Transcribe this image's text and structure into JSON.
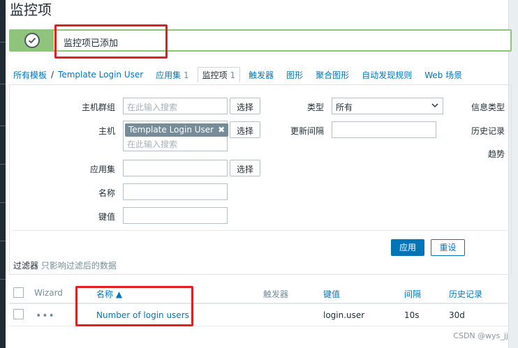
{
  "page": {
    "title": "监控项"
  },
  "message": {
    "text": "监控项已添加",
    "icon": "check-circle-icon",
    "color": "#8fc47d"
  },
  "breadcrumbs": {
    "all_templates": "所有模板",
    "separator": "/",
    "template": "Template Login User",
    "tabs": [
      {
        "label": "应用集",
        "count": "1"
      },
      {
        "label": "监控项",
        "count": "1"
      },
      {
        "label": "触发器",
        "count": ""
      },
      {
        "label": "图形",
        "count": ""
      },
      {
        "label": "聚合图形",
        "count": ""
      },
      {
        "label": "自动发现规则",
        "count": ""
      },
      {
        "label": "Web 场景",
        "count": ""
      }
    ]
  },
  "filter": {
    "host_group_label": "主机群组",
    "host_group_placeholder": "在此输入搜索",
    "select_label": "选择",
    "host_label": "主机",
    "host_tag": "Template Login User",
    "host_tag_remove": "✖",
    "host_placeholder": "在此输入搜索",
    "app_label": "应用集",
    "name_label": "名称",
    "key_label": "键值",
    "type_label": "类型",
    "type_value": "所有",
    "interval_label": "更新间隔",
    "info_type_label": "信息类型",
    "history_label": "历史记录",
    "trend_label": "趋势",
    "apply_label": "应用",
    "reset_label": "重设",
    "note_title": "过滤器",
    "note_text": "只影响过滤后的数据"
  },
  "table": {
    "headers": {
      "wizard": "Wizard",
      "name": "名称 ▲",
      "triggers": "触发器",
      "key": "键值",
      "interval": "间隔",
      "history": "历史记录"
    },
    "rows": [
      {
        "wizard": "•••",
        "name": "Number of login users",
        "triggers": "",
        "key": "login.user",
        "interval": "10s",
        "history": "30d"
      }
    ]
  },
  "watermark": "CSDN @wys_jj",
  "colors": {
    "accent": "#0275b8",
    "success": "#8fc47d",
    "highlight": "#e02020"
  }
}
